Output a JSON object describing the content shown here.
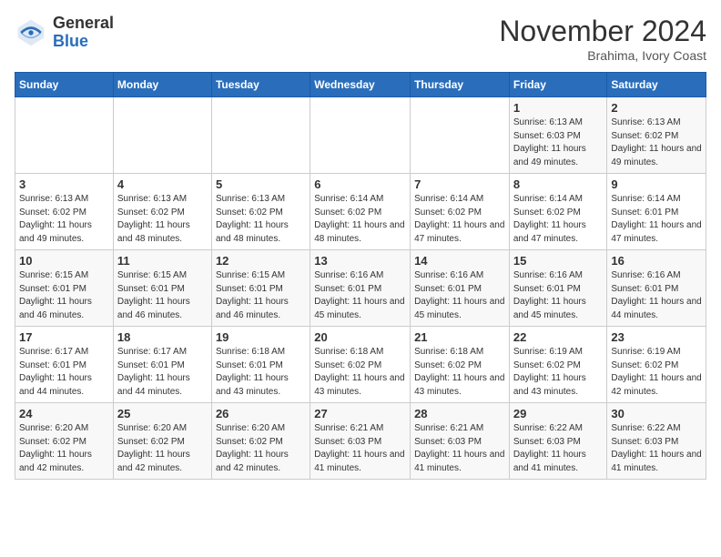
{
  "logo": {
    "general": "General",
    "blue": "Blue"
  },
  "header": {
    "month": "November 2024",
    "location": "Brahima, Ivory Coast"
  },
  "days_of_week": [
    "Sunday",
    "Monday",
    "Tuesday",
    "Wednesday",
    "Thursday",
    "Friday",
    "Saturday"
  ],
  "weeks": [
    [
      {
        "day": "",
        "info": ""
      },
      {
        "day": "",
        "info": ""
      },
      {
        "day": "",
        "info": ""
      },
      {
        "day": "",
        "info": ""
      },
      {
        "day": "",
        "info": ""
      },
      {
        "day": "1",
        "info": "Sunrise: 6:13 AM\nSunset: 6:03 PM\nDaylight: 11 hours and 49 minutes."
      },
      {
        "day": "2",
        "info": "Sunrise: 6:13 AM\nSunset: 6:02 PM\nDaylight: 11 hours and 49 minutes."
      }
    ],
    [
      {
        "day": "3",
        "info": "Sunrise: 6:13 AM\nSunset: 6:02 PM\nDaylight: 11 hours and 49 minutes."
      },
      {
        "day": "4",
        "info": "Sunrise: 6:13 AM\nSunset: 6:02 PM\nDaylight: 11 hours and 48 minutes."
      },
      {
        "day": "5",
        "info": "Sunrise: 6:13 AM\nSunset: 6:02 PM\nDaylight: 11 hours and 48 minutes."
      },
      {
        "day": "6",
        "info": "Sunrise: 6:14 AM\nSunset: 6:02 PM\nDaylight: 11 hours and 48 minutes."
      },
      {
        "day": "7",
        "info": "Sunrise: 6:14 AM\nSunset: 6:02 PM\nDaylight: 11 hours and 47 minutes."
      },
      {
        "day": "8",
        "info": "Sunrise: 6:14 AM\nSunset: 6:02 PM\nDaylight: 11 hours and 47 minutes."
      },
      {
        "day": "9",
        "info": "Sunrise: 6:14 AM\nSunset: 6:01 PM\nDaylight: 11 hours and 47 minutes."
      }
    ],
    [
      {
        "day": "10",
        "info": "Sunrise: 6:15 AM\nSunset: 6:01 PM\nDaylight: 11 hours and 46 minutes."
      },
      {
        "day": "11",
        "info": "Sunrise: 6:15 AM\nSunset: 6:01 PM\nDaylight: 11 hours and 46 minutes."
      },
      {
        "day": "12",
        "info": "Sunrise: 6:15 AM\nSunset: 6:01 PM\nDaylight: 11 hours and 46 minutes."
      },
      {
        "day": "13",
        "info": "Sunrise: 6:16 AM\nSunset: 6:01 PM\nDaylight: 11 hours and 45 minutes."
      },
      {
        "day": "14",
        "info": "Sunrise: 6:16 AM\nSunset: 6:01 PM\nDaylight: 11 hours and 45 minutes."
      },
      {
        "day": "15",
        "info": "Sunrise: 6:16 AM\nSunset: 6:01 PM\nDaylight: 11 hours and 45 minutes."
      },
      {
        "day": "16",
        "info": "Sunrise: 6:16 AM\nSunset: 6:01 PM\nDaylight: 11 hours and 44 minutes."
      }
    ],
    [
      {
        "day": "17",
        "info": "Sunrise: 6:17 AM\nSunset: 6:01 PM\nDaylight: 11 hours and 44 minutes."
      },
      {
        "day": "18",
        "info": "Sunrise: 6:17 AM\nSunset: 6:01 PM\nDaylight: 11 hours and 44 minutes."
      },
      {
        "day": "19",
        "info": "Sunrise: 6:18 AM\nSunset: 6:01 PM\nDaylight: 11 hours and 43 minutes."
      },
      {
        "day": "20",
        "info": "Sunrise: 6:18 AM\nSunset: 6:02 PM\nDaylight: 11 hours and 43 minutes."
      },
      {
        "day": "21",
        "info": "Sunrise: 6:18 AM\nSunset: 6:02 PM\nDaylight: 11 hours and 43 minutes."
      },
      {
        "day": "22",
        "info": "Sunrise: 6:19 AM\nSunset: 6:02 PM\nDaylight: 11 hours and 43 minutes."
      },
      {
        "day": "23",
        "info": "Sunrise: 6:19 AM\nSunset: 6:02 PM\nDaylight: 11 hours and 42 minutes."
      }
    ],
    [
      {
        "day": "24",
        "info": "Sunrise: 6:20 AM\nSunset: 6:02 PM\nDaylight: 11 hours and 42 minutes."
      },
      {
        "day": "25",
        "info": "Sunrise: 6:20 AM\nSunset: 6:02 PM\nDaylight: 11 hours and 42 minutes."
      },
      {
        "day": "26",
        "info": "Sunrise: 6:20 AM\nSunset: 6:02 PM\nDaylight: 11 hours and 42 minutes."
      },
      {
        "day": "27",
        "info": "Sunrise: 6:21 AM\nSunset: 6:03 PM\nDaylight: 11 hours and 41 minutes."
      },
      {
        "day": "28",
        "info": "Sunrise: 6:21 AM\nSunset: 6:03 PM\nDaylight: 11 hours and 41 minutes."
      },
      {
        "day": "29",
        "info": "Sunrise: 6:22 AM\nSunset: 6:03 PM\nDaylight: 11 hours and 41 minutes."
      },
      {
        "day": "30",
        "info": "Sunrise: 6:22 AM\nSunset: 6:03 PM\nDaylight: 11 hours and 41 minutes."
      }
    ]
  ]
}
